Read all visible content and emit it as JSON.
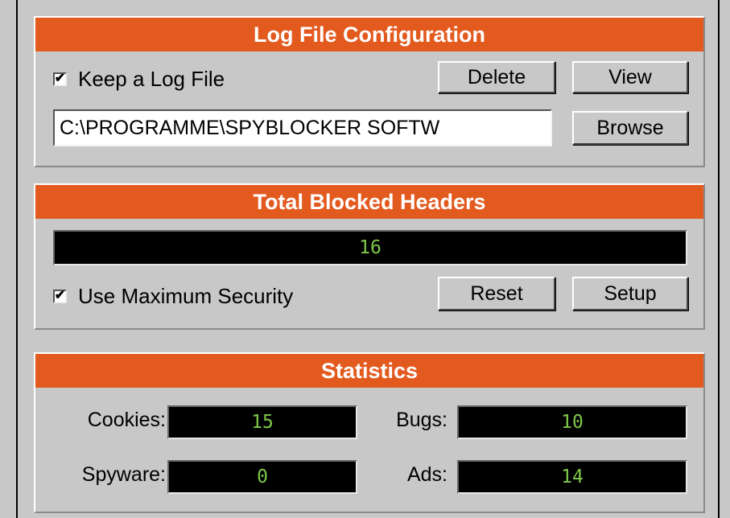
{
  "log_section": {
    "title": "Log File Configuration",
    "keep_log_label": "Keep a Log File",
    "keep_log_checked": true,
    "delete_label": "Delete",
    "view_label": "View",
    "path_value": "C:\\PROGRAMME\\SPYBLOCKER SOFTW",
    "browse_label": "Browse"
  },
  "blocked_section": {
    "title": "Total Blocked Headers",
    "total_value": "16",
    "max_security_label": "Use Maximum Security",
    "max_security_checked": true,
    "reset_label": "Reset",
    "setup_label": "Setup"
  },
  "stats_section": {
    "title": "Statistics",
    "cookies_label": "Cookies:",
    "cookies_value": "15",
    "bugs_label": "Bugs:",
    "bugs_value": "10",
    "spyware_label": "Spyware:",
    "spyware_value": "0",
    "ads_label": "Ads:",
    "ads_value": "14"
  },
  "colors": {
    "header_bg": "#e35a1f",
    "panel_bg": "#c8c8c8",
    "display_bg": "#000000",
    "display_text": "#7ec84a"
  },
  "icons": {
    "checkmark": "check-icon"
  }
}
